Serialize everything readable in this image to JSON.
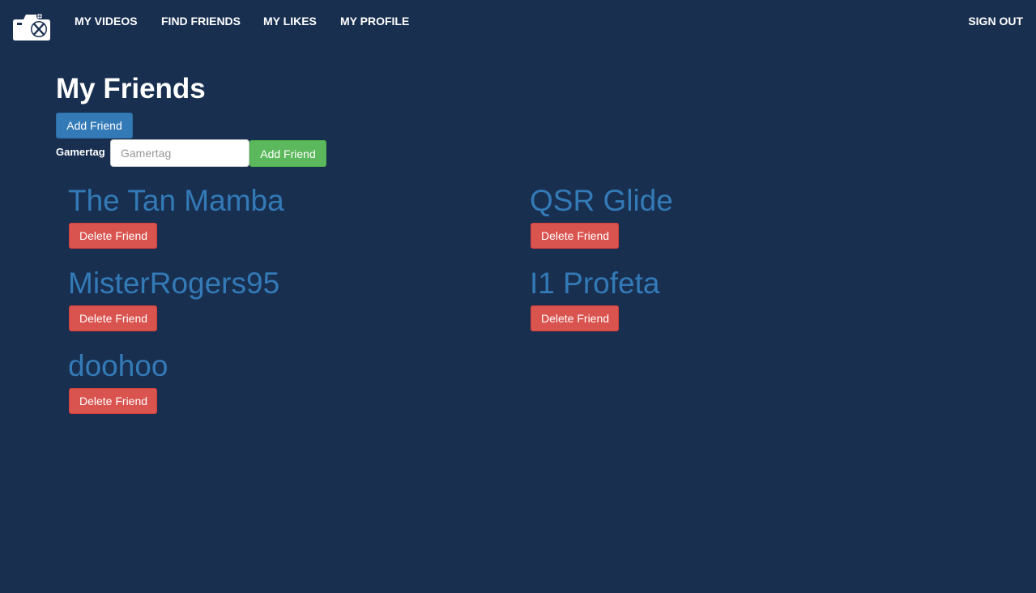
{
  "nav": {
    "logo_icon": "xbox-camera-icon",
    "links": [
      "MY VIDEOS",
      "FIND FRIENDS",
      "MY LIKES",
      "MY PROFILE"
    ],
    "sign_out": "SIGN OUT"
  },
  "page": {
    "title": "My Friends",
    "add_toggle_label": "Add Friend"
  },
  "form": {
    "label": "Gamertag",
    "value": "",
    "placeholder": "Gamertag",
    "submit_label": "Add Friend"
  },
  "friends": [
    {
      "name": "The Tan Mamba",
      "delete_label": "Delete Friend"
    },
    {
      "name": "QSR Glide",
      "delete_label": "Delete Friend"
    },
    {
      "name": "MisterRogers95",
      "delete_label": "Delete Friend"
    },
    {
      "name": "I1 Profeta",
      "delete_label": "Delete Friend"
    },
    {
      "name": "doohoo",
      "delete_label": "Delete Friend"
    }
  ],
  "colors": {
    "background": "#182f50",
    "link": "#337ab7",
    "primary": "#337ab7",
    "success": "#5cb85c",
    "danger": "#d9534f"
  }
}
